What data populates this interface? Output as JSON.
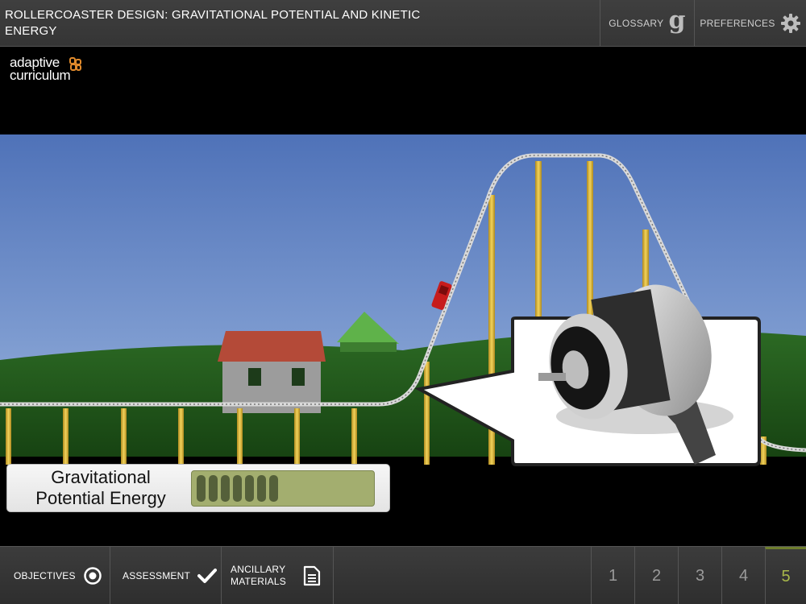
{
  "header": {
    "title": "ROLLERCOASTER DESIGN: GRAVITATIONAL POTENTIAL AND KINETIC ENERGY",
    "glossary_label": "GLOSSARY",
    "glossary_icon": "g",
    "preferences_label": "PREFERENCES"
  },
  "logo": {
    "line1": "adaptive",
    "line2": "curriculum",
    "accent_color": "#e08a2c"
  },
  "meter": {
    "label_line1": "Gravitational",
    "label_line2": "Potential Energy",
    "level_ticks": 7,
    "bar_color": "#a3ae6f",
    "tick_color": "#55603a"
  },
  "footer": {
    "objectives_label": "OBJECTIVES",
    "assessment_label": "ASSESSMENT",
    "ancillary_label": "ANCILLARY MATERIALS",
    "pages": [
      "1",
      "2",
      "3",
      "4",
      "5"
    ],
    "active_page": "5",
    "active_color": "#a8b84a"
  },
  "icons": {
    "glossary": "g-icon",
    "preferences": "gear-icon",
    "objectives": "target-icon",
    "assessment": "checkmark-icon",
    "ancillary": "document-icon"
  }
}
